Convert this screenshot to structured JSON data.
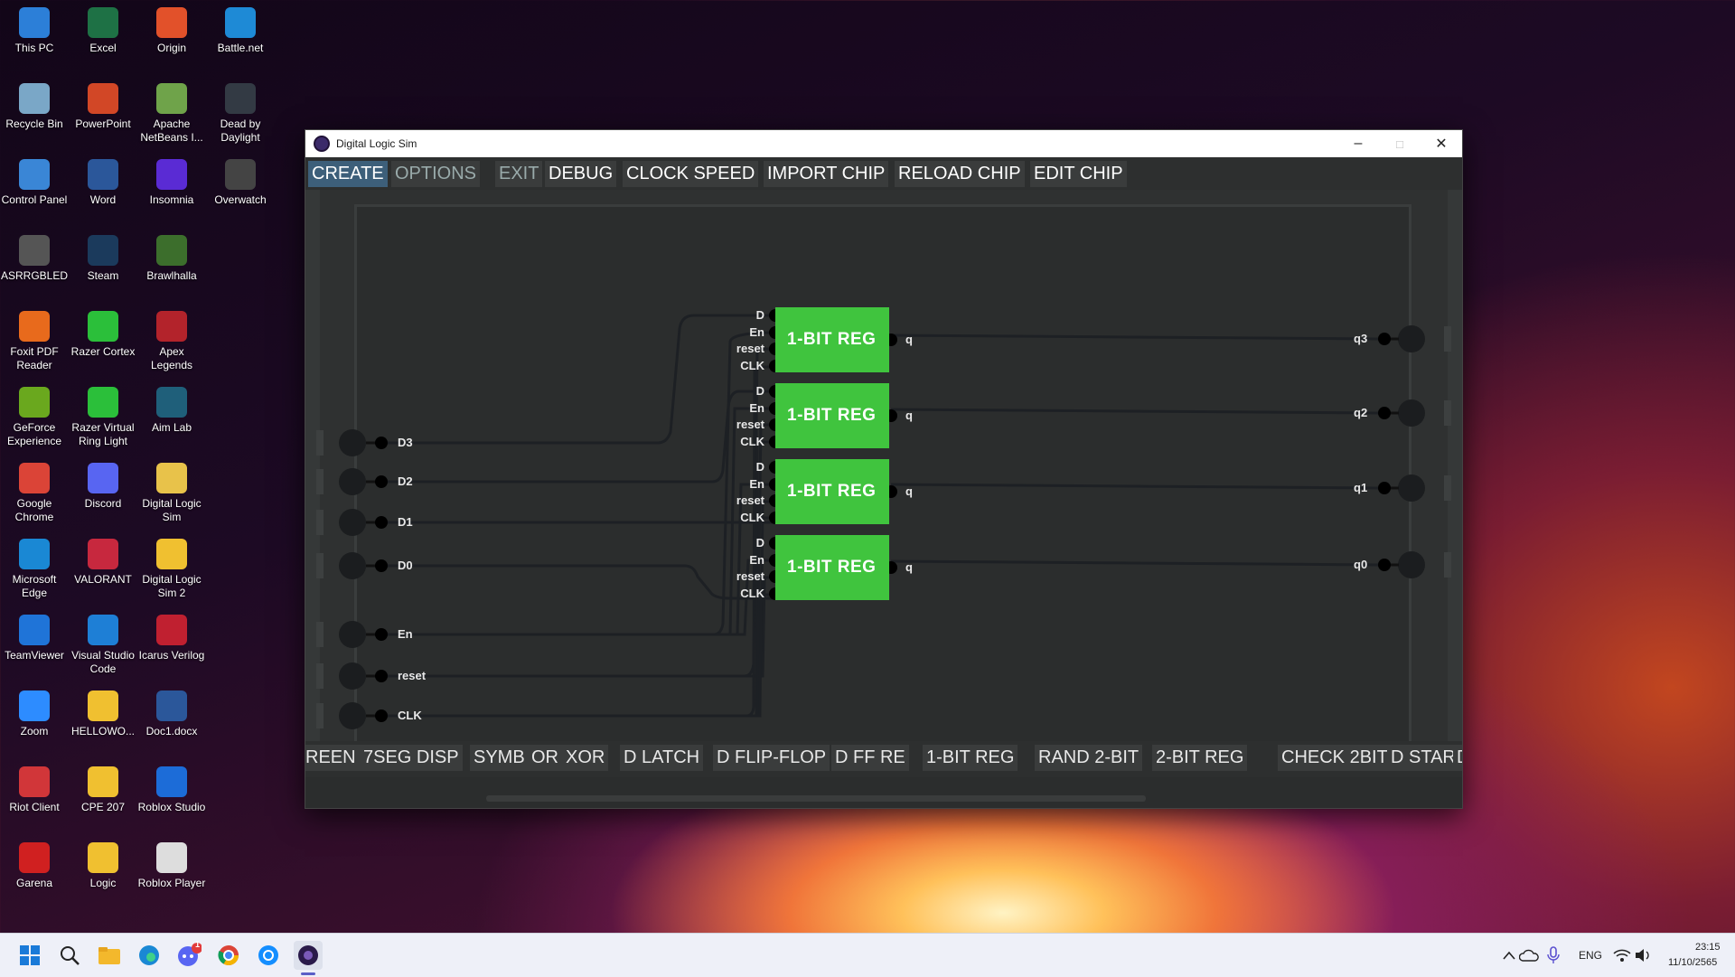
{
  "desktop": {
    "icons": [
      {
        "label": "This PC",
        "color": "#2c7fd8"
      },
      {
        "label": "Excel",
        "color": "#1e7145"
      },
      {
        "label": "Origin",
        "color": "#e2512a"
      },
      {
        "label": "Battle.net",
        "color": "#1e8ad6"
      },
      {
        "label": "Recycle Bin",
        "color": "#7aa7c7"
      },
      {
        "label": "PowerPoint",
        "color": "#d24726"
      },
      {
        "label": "Apache NetBeans I...",
        "color": "#6fa34a"
      },
      {
        "label": "Dead by Daylight",
        "color": "#333a44"
      },
      {
        "label": "Control Panel",
        "color": "#3a86d6"
      },
      {
        "label": "Word",
        "color": "#2b579a"
      },
      {
        "label": "Insomnia",
        "color": "#5a2bd4"
      },
      {
        "label": "Overwatch",
        "color": "#444"
      },
      {
        "label": "ASRRGBLED",
        "color": "#555"
      },
      {
        "label": "Steam",
        "color": "#1b3a5c"
      },
      {
        "label": "Brawlhalla",
        "color": "#3c6e2c"
      },
      {
        "label": "Foxit PDF Reader",
        "color": "#e86a1c"
      },
      {
        "label": "Razer Cortex",
        "color": "#2bbf3a"
      },
      {
        "label": "Apex Legends",
        "color": "#b3232b"
      },
      {
        "label": "GeForce Experience",
        "color": "#6aa81e"
      },
      {
        "label": "Razer Virtual Ring Light",
        "color": "#2bbf3a"
      },
      {
        "label": "Aim Lab",
        "color": "#1f5f7a"
      },
      {
        "label": "Google Chrome",
        "color": "#db4437"
      },
      {
        "label": "Discord",
        "color": "#5865f2"
      },
      {
        "label": "Digital Logic Sim",
        "color": "#e8c24a"
      },
      {
        "label": "Microsoft Edge",
        "color": "#1a88d4"
      },
      {
        "label": "VALORANT",
        "color": "#c7283e"
      },
      {
        "label": "Digital Logic Sim 2",
        "color": "#f0c030"
      },
      {
        "label": "TeamViewer",
        "color": "#1f74d8"
      },
      {
        "label": "Visual Studio Code",
        "color": "#1e7fd6"
      },
      {
        "label": "Icarus Verilog",
        "color": "#c02030"
      },
      {
        "label": "Zoom",
        "color": "#2d8cff"
      },
      {
        "label": "HELLOWO...",
        "color": "#f0c030"
      },
      {
        "label": "Doc1.docx",
        "color": "#2b579a"
      },
      {
        "label": "Riot Client",
        "color": "#d13639"
      },
      {
        "label": "CPE 207",
        "color": "#f0c030"
      },
      {
        "label": "Roblox Studio",
        "color": "#1c6cd8"
      },
      {
        "label": "Garena",
        "color": "#d02020"
      },
      {
        "label": "Logic",
        "color": "#f0c030"
      },
      {
        "label": "Roblox Player",
        "color": "#ddd"
      }
    ]
  },
  "window": {
    "title": "Digital Logic Sim",
    "minimize": "–",
    "maximize": "□",
    "close": "✕"
  },
  "menu": [
    "CREATE",
    "OPTIONS",
    "EXIT",
    "DEBUG",
    "CLOCK SPEED",
    "IMPORT CHIP",
    "RELOAD CHIP",
    "EDIT CHIP"
  ],
  "inputs": [
    "D3",
    "D2",
    "D1",
    "D0",
    "En",
    "reset",
    "CLK"
  ],
  "chips": [
    {
      "label": "1-BIT REG",
      "pins": [
        "D",
        "En",
        "reset",
        "CLK"
      ],
      "output": "q"
    },
    {
      "label": "1-BIT REG",
      "pins": [
        "D",
        "En",
        "reset",
        "CLK"
      ],
      "output": "q"
    },
    {
      "label": "1-BIT REG",
      "pins": [
        "D",
        "En",
        "reset",
        "CLK"
      ],
      "output": "q"
    },
    {
      "label": "1-BIT REG",
      "pins": [
        "D",
        "En",
        "reset",
        "CLK"
      ],
      "output": "q"
    }
  ],
  "outputs": [
    "q3",
    "q2",
    "q1",
    "q0"
  ],
  "library": [
    "REEN",
    "7SEG DISP",
    "SYMB",
    "OR",
    "XOR",
    "D LATCH",
    "D FLIP-FLOP",
    "D FF RE",
    "1-BIT REG",
    "RAND 2-BIT",
    "2-BIT REG",
    "CHECK 2BIT",
    "D STAR",
    "DEC"
  ],
  "taskbar": {
    "lang": "ENG",
    "time": "23:15",
    "date": "11/10/2565",
    "discord_badge": "1"
  }
}
